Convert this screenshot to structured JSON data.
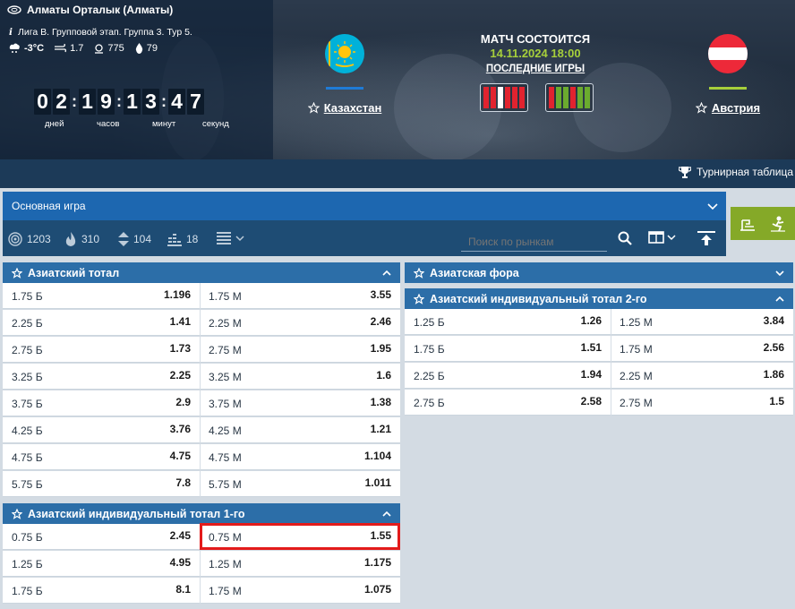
{
  "header": {
    "venue": "Алматы Орталык (Алматы)",
    "league": "Лига B. Групповой этап. Группа 3. Тур 5.",
    "weather": {
      "temp": "-3°C",
      "wind": "1.7",
      "pressure": "775",
      "humidity": "79"
    },
    "countdown": {
      "digits": [
        "0",
        "2",
        "1",
        "9",
        "1",
        "3",
        "4",
        "7"
      ],
      "labels": [
        "дней",
        "часов",
        "минут",
        "секунд"
      ]
    },
    "home_team": {
      "name": "Казахстан",
      "bar_color": "#1f7bd6"
    },
    "away_team": {
      "name": "Австрия",
      "bar_color": "#a6cf3b"
    },
    "status_title": "МАТЧ СОСТОИТСЯ",
    "match_datetime": "14.11.2024 18:00",
    "last_games": "ПОСЛЕДНИЕ ИГРЫ",
    "home_form": [
      "#e1232f",
      "#e1232f",
      "#ffffff",
      "#e1232f",
      "#e1232f",
      "#e1232f"
    ],
    "away_form": [
      "#e1232f",
      "#6bab2e",
      "#6bab2e",
      "#e1232f",
      "#6bab2e",
      "#6bab2e"
    ],
    "standings": "Турнирная таблица"
  },
  "toolbar": {
    "main_game": "Основная игра",
    "stats": {
      "markets": "1203",
      "hot": "310",
      "live": "104",
      "stats": "18"
    },
    "search_placeholder": "Поиск по рынкам"
  },
  "markets": {
    "asian_total": {
      "title": "Азиатский тотал",
      "rows": [
        {
          "over": "1.75 Б",
          "over_odd": "1.196",
          "under": "1.75 М",
          "under_odd": "3.55"
        },
        {
          "over": "2.25 Б",
          "over_odd": "1.41",
          "under": "2.25 М",
          "under_odd": "2.46"
        },
        {
          "over": "2.75 Б",
          "over_odd": "1.73",
          "under": "2.75 М",
          "under_odd": "1.95"
        },
        {
          "over": "3.25 Б",
          "over_odd": "2.25",
          "under": "3.25 М",
          "under_odd": "1.6"
        },
        {
          "over": "3.75 Б",
          "over_odd": "2.9",
          "under": "3.75 М",
          "under_odd": "1.38"
        },
        {
          "over": "4.25 Б",
          "over_odd": "3.76",
          "under": "4.25 М",
          "under_odd": "1.21"
        },
        {
          "over": "4.75 Б",
          "over_odd": "4.75",
          "under": "4.75 М",
          "under_odd": "1.104"
        },
        {
          "over": "5.75 Б",
          "over_odd": "7.8",
          "under": "5.75 М",
          "under_odd": "1.011"
        }
      ]
    },
    "asian_individual_1": {
      "title": "Азиатский индивидуальный тотал 1-го",
      "rows": [
        {
          "over": "0.75 Б",
          "over_odd": "2.45",
          "under": "0.75 М",
          "under_odd": "1.55"
        },
        {
          "over": "1.25 Б",
          "over_odd": "4.95",
          "under": "1.25 М",
          "under_odd": "1.175"
        },
        {
          "over": "1.75 Б",
          "over_odd": "8.1",
          "under": "1.75 М",
          "under_odd": "1.075"
        }
      ]
    },
    "asian_handicap": {
      "title": "Азиатская фора"
    },
    "asian_individual_2": {
      "title": "Азиатский индивидуальный тотал 2-го",
      "rows": [
        {
          "over": "1.25 Б",
          "over_odd": "1.26",
          "under": "1.25 М",
          "under_odd": "3.84"
        },
        {
          "over": "1.75 Б",
          "over_odd": "1.51",
          "under": "1.75 М",
          "under_odd": "2.56"
        },
        {
          "over": "2.25 Б",
          "over_odd": "1.94",
          "under": "2.25 М",
          "under_odd": "1.86"
        },
        {
          "over": "2.75 Б",
          "over_odd": "2.58",
          "under": "2.75 М",
          "under_odd": "1.5"
        }
      ]
    }
  }
}
